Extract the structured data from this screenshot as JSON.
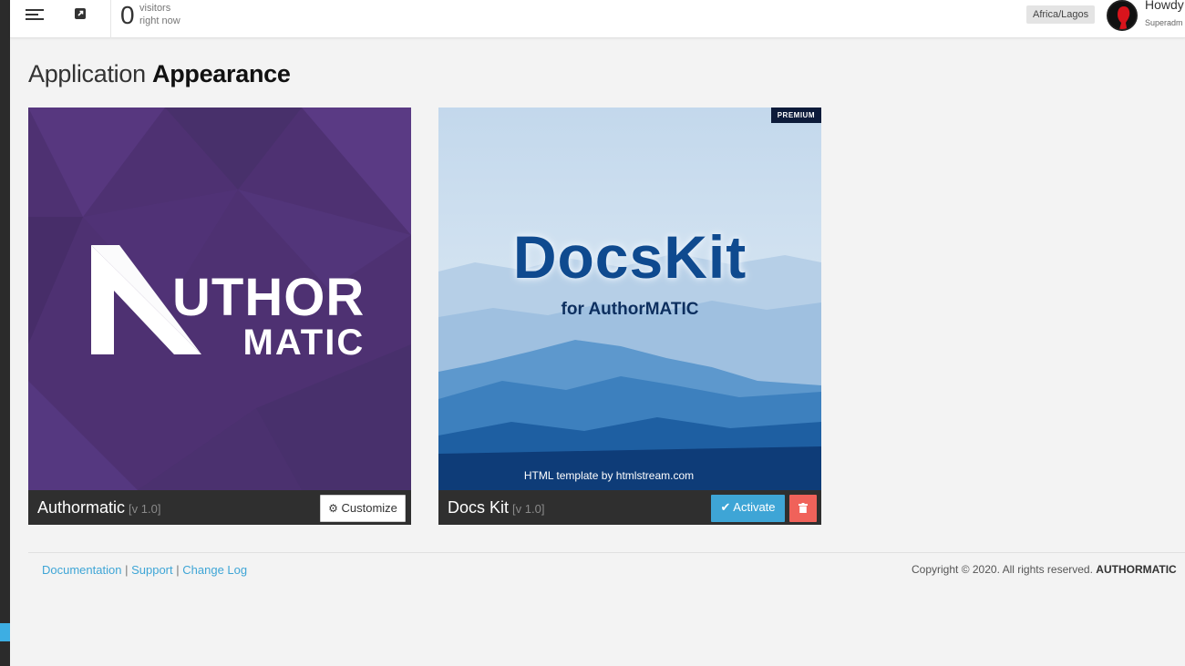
{
  "topbar": {
    "visitor_count": "0",
    "visitor_label_1": "visitors",
    "visitor_label_2": "right now",
    "timezone": "Africa/Lagos",
    "greeting": "Howdy",
    "user_role": "Superadm"
  },
  "page": {
    "title_light": "Application",
    "title_bold": "Appearance"
  },
  "themes": [
    {
      "name": "Authormatic",
      "version": "[v 1.0]",
      "logo_line1": "UTHOR",
      "logo_line2": "MATIC",
      "action_label": "Customize",
      "action_icon": "gear-icon"
    },
    {
      "name": "Docs Kit",
      "version": "[v 1.0]",
      "badge": "PREMIUM",
      "logo_title": "DocsKit",
      "logo_subtitle": "for AuthorMATIC",
      "logo_caption": "HTML template by htmlstream.com",
      "action_label": "Activate",
      "action_icon": "check-icon",
      "delete_icon": "trash-icon"
    }
  ],
  "footer": {
    "links": [
      "Documentation",
      "Support",
      "Change Log"
    ],
    "separator": "|",
    "copyright": "Copyright © 2020. All rights reserved.",
    "brand": "AUTHORMATIC"
  },
  "colors": {
    "accent": "#3ea5d6",
    "danger": "#f0625a",
    "purple": "#4e3172",
    "sidebar": "#2b2b2b"
  }
}
